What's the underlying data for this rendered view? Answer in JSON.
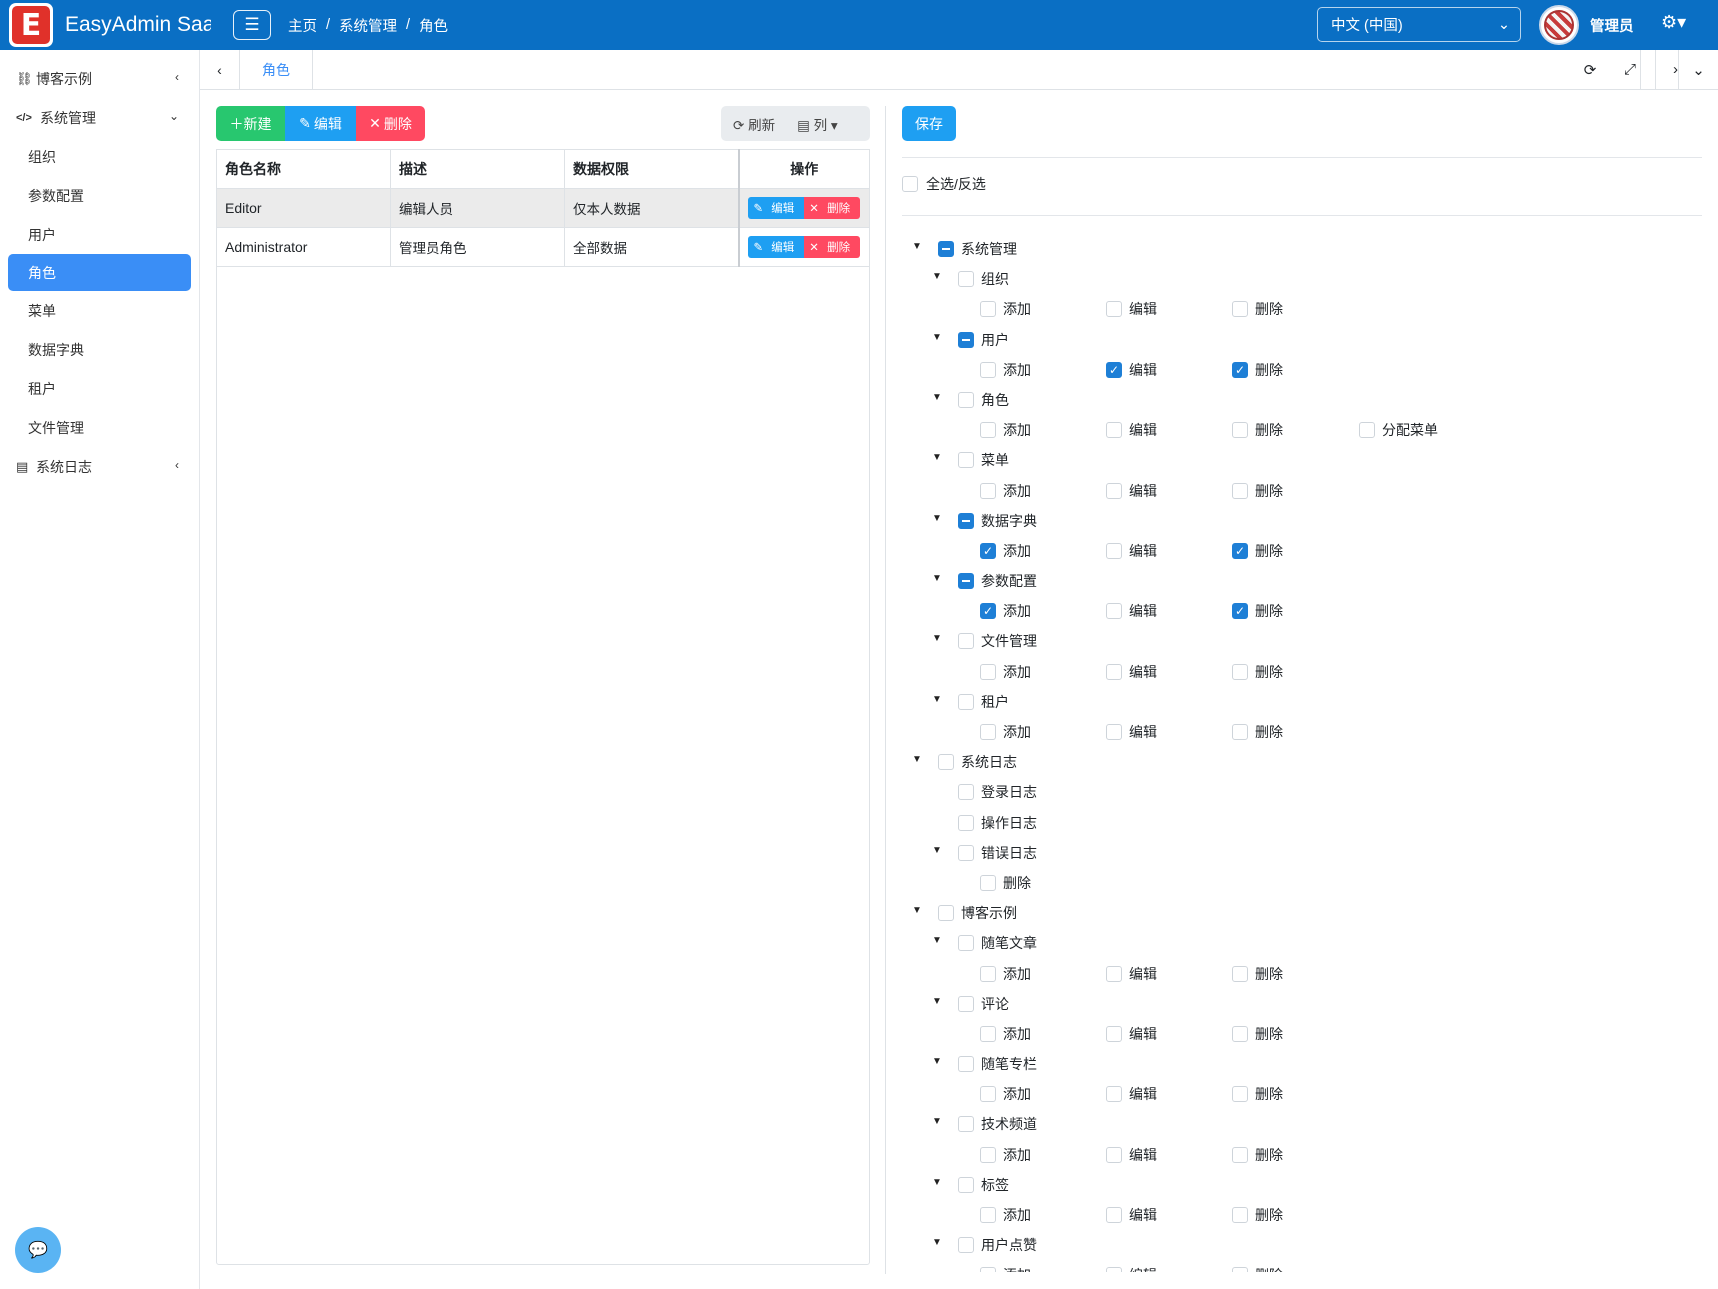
{
  "header": {
    "logo_letter": "E",
    "brand": "EasyAdmin Saa",
    "breadcrumb": [
      "主页",
      "系统管理",
      "角色"
    ],
    "language": "中文 (中国)",
    "user_name": "管理员"
  },
  "sidebar": {
    "items": [
      {
        "label": "博客示例",
        "icon": "link-icon",
        "level": 0,
        "arrow": "‹"
      },
      {
        "label": "系统管理",
        "icon": "code-icon",
        "level": 0,
        "arrow": "⌄"
      },
      {
        "label": "组织",
        "level": 1
      },
      {
        "label": "参数配置",
        "level": 1
      },
      {
        "label": "用户",
        "level": 1
      },
      {
        "label": "角色",
        "level": 1,
        "active": true
      },
      {
        "label": "菜单",
        "level": 1
      },
      {
        "label": "数据字典",
        "level": 1
      },
      {
        "label": "租户",
        "level": 1
      },
      {
        "label": "文件管理",
        "level": 1
      },
      {
        "label": "系统日志",
        "icon": "server-icon",
        "level": 0,
        "arrow": "‹"
      }
    ]
  },
  "tabs": {
    "active": "角色"
  },
  "toolbar": {
    "new_label": "新建",
    "edit_label": "编辑",
    "delete_label": "删除",
    "refresh_label": "刷新",
    "columns_label": "列"
  },
  "table": {
    "headers": [
      "角色名称",
      "描述",
      "数据权限",
      "操作"
    ],
    "rows": [
      {
        "name": "Editor",
        "description": "编辑人员",
        "data_scope": "仅本人数据",
        "selected": true
      },
      {
        "name": "Administrator",
        "description": "管理员角色",
        "data_scope": "全部数据",
        "selected": false
      }
    ],
    "row_edit_label": "编辑",
    "row_delete_label": "删除"
  },
  "permissions": {
    "save_label": "保存",
    "select_all_label": "全选/反选",
    "tree": [
      {
        "label": "系统管理",
        "level": 0,
        "state": "ind",
        "caret": true
      },
      {
        "label": "组织",
        "level": 1,
        "state": "none",
        "caret": true
      },
      {
        "perms": [
          [
            "添加",
            "none"
          ],
          [
            "编辑",
            "none"
          ],
          [
            "删除",
            "none"
          ]
        ]
      },
      {
        "label": "用户",
        "level": 1,
        "state": "ind",
        "caret": true
      },
      {
        "perms": [
          [
            "添加",
            "none"
          ],
          [
            "编辑",
            "checked"
          ],
          [
            "删除",
            "checked"
          ]
        ]
      },
      {
        "label": "角色",
        "level": 1,
        "state": "none",
        "caret": true
      },
      {
        "perms": [
          [
            "添加",
            "none"
          ],
          [
            "编辑",
            "none"
          ],
          [
            "删除",
            "none"
          ],
          [
            "分配菜单",
            "none"
          ]
        ]
      },
      {
        "label": "菜单",
        "level": 1,
        "state": "none",
        "caret": true
      },
      {
        "perms": [
          [
            "添加",
            "none"
          ],
          [
            "编辑",
            "none"
          ],
          [
            "删除",
            "none"
          ]
        ]
      },
      {
        "label": "数据字典",
        "level": 1,
        "state": "ind",
        "caret": true
      },
      {
        "perms": [
          [
            "添加",
            "checked"
          ],
          [
            "编辑",
            "none"
          ],
          [
            "删除",
            "checked"
          ]
        ]
      },
      {
        "label": "参数配置",
        "level": 1,
        "state": "ind",
        "caret": true
      },
      {
        "perms": [
          [
            "添加",
            "checked"
          ],
          [
            "编辑",
            "none"
          ],
          [
            "删除",
            "checked"
          ]
        ]
      },
      {
        "label": "文件管理",
        "level": 1,
        "state": "none",
        "caret": true
      },
      {
        "perms": [
          [
            "添加",
            "none"
          ],
          [
            "编辑",
            "none"
          ],
          [
            "删除",
            "none"
          ]
        ]
      },
      {
        "label": "租户",
        "level": 1,
        "state": "none",
        "caret": true
      },
      {
        "perms": [
          [
            "添加",
            "none"
          ],
          [
            "编辑",
            "none"
          ],
          [
            "删除",
            "none"
          ]
        ]
      },
      {
        "label": "系统日志",
        "level": 0,
        "state": "none",
        "caret": true
      },
      {
        "label": "登录日志",
        "level": 1,
        "state": "none",
        "caret": false
      },
      {
        "label": "操作日志",
        "level": 1,
        "state": "none",
        "caret": false
      },
      {
        "label": "错误日志",
        "level": 1,
        "state": "none",
        "caret": true
      },
      {
        "perms": [
          [
            "删除",
            "none"
          ]
        ]
      },
      {
        "label": "博客示例",
        "level": 0,
        "state": "none",
        "caret": true
      },
      {
        "label": "随笔文章",
        "level": 1,
        "state": "none",
        "caret": true
      },
      {
        "perms": [
          [
            "添加",
            "none"
          ],
          [
            "编辑",
            "none"
          ],
          [
            "删除",
            "none"
          ]
        ]
      },
      {
        "label": "评论",
        "level": 1,
        "state": "none",
        "caret": true
      },
      {
        "perms": [
          [
            "添加",
            "none"
          ],
          [
            "编辑",
            "none"
          ],
          [
            "删除",
            "none"
          ]
        ]
      },
      {
        "label": "随笔专栏",
        "level": 1,
        "state": "none",
        "caret": true
      },
      {
        "perms": [
          [
            "添加",
            "none"
          ],
          [
            "编辑",
            "none"
          ],
          [
            "删除",
            "none"
          ]
        ]
      },
      {
        "label": "技术频道",
        "level": 1,
        "state": "none",
        "caret": true
      },
      {
        "perms": [
          [
            "添加",
            "none"
          ],
          [
            "编辑",
            "none"
          ],
          [
            "删除",
            "none"
          ]
        ]
      },
      {
        "label": "标签",
        "level": 1,
        "state": "none",
        "caret": true
      },
      {
        "perms": [
          [
            "添加",
            "none"
          ],
          [
            "编辑",
            "none"
          ],
          [
            "删除",
            "none"
          ]
        ]
      },
      {
        "label": "用户点赞",
        "level": 1,
        "state": "none",
        "caret": true
      },
      {
        "perms": [
          [
            "添加",
            "none"
          ],
          [
            "编辑",
            "none"
          ],
          [
            "删除",
            "none"
          ]
        ]
      }
    ]
  }
}
